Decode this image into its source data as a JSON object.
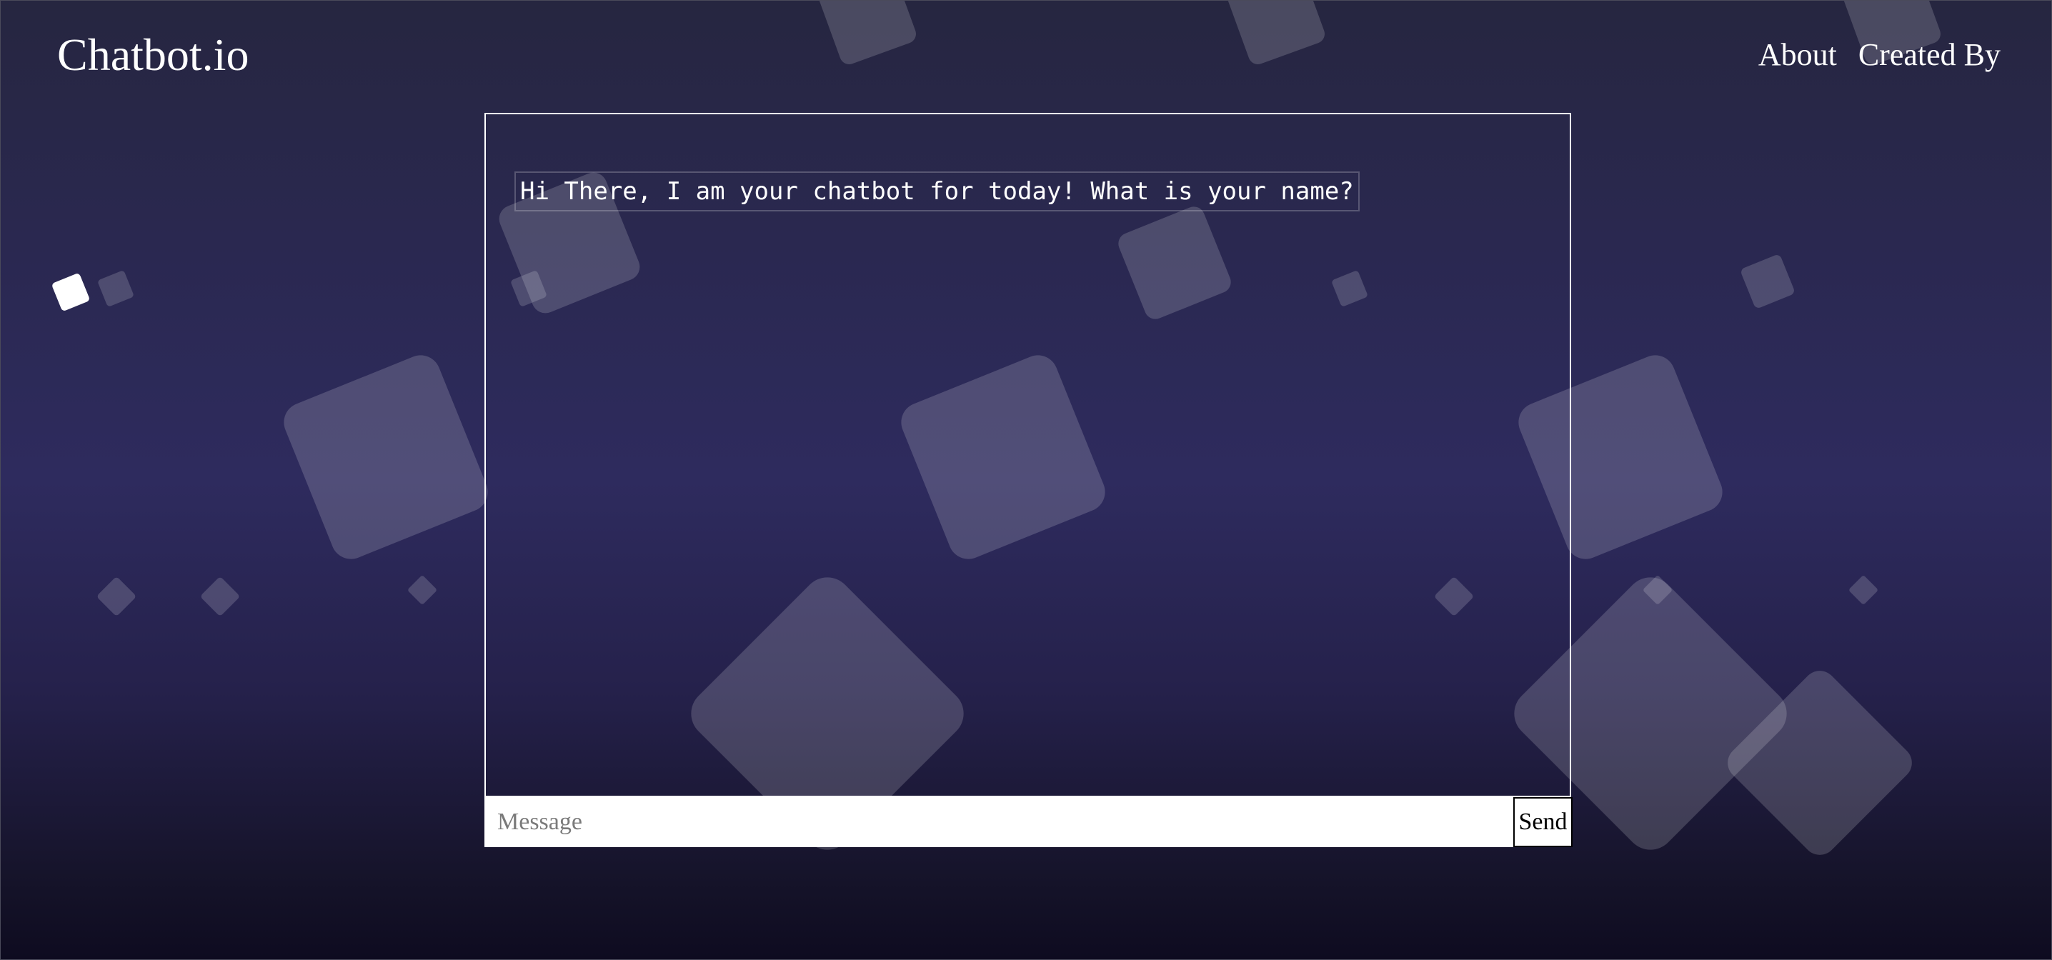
{
  "app": {
    "title": "Chatbot.io"
  },
  "nav": {
    "items": [
      "About",
      "Created By"
    ]
  },
  "chat": {
    "messages": [
      {
        "sender": "bot",
        "text": "Hi There, I am your chatbot for today! What is your name?"
      }
    ]
  },
  "composer": {
    "placeholder": "Message",
    "value": "",
    "send_label": "Send"
  },
  "colors": {
    "background_top": "#262640",
    "background_mid": "#2e2b5e",
    "background_bottom": "#0e0b20",
    "text": "#ffffff"
  }
}
